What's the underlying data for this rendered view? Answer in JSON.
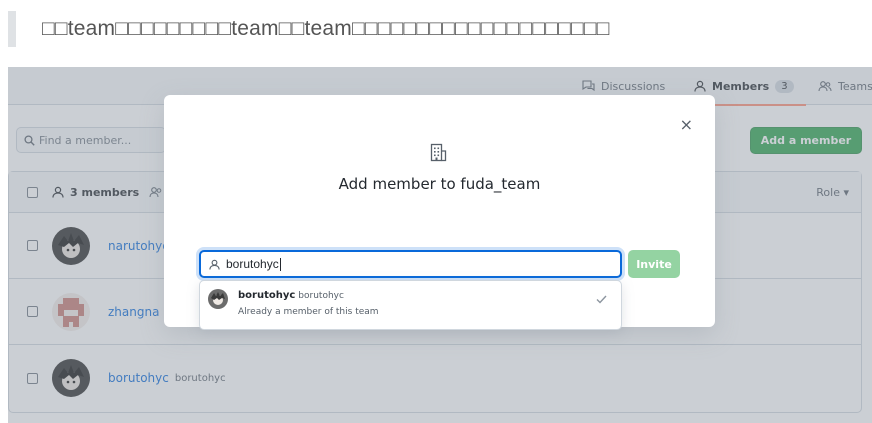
{
  "doc": {
    "heading": "□□team□□□□□□□□□team□□team□□□□□□□□□□□□□□□□□□□□"
  },
  "tabs": {
    "discussions": "Discussions",
    "members": "Members",
    "members_count": "3",
    "teams": "Teams"
  },
  "toolbar": {
    "find_placeholder": "Find a member...",
    "add_member": "Add a member"
  },
  "members": {
    "header_count": "3 members",
    "role_label": "Role ▾",
    "rows": [
      {
        "name": "narutohyc",
        "login": ""
      },
      {
        "name": "zhangna",
        "login": ""
      },
      {
        "name": "borutohyc",
        "login": "borutohyc"
      }
    ]
  },
  "dialog": {
    "title": "Add member to fuda_team",
    "close": "×",
    "search_value": "borutohyc",
    "invite": "Invite",
    "suggestion": {
      "name": "borutohyc",
      "login": "borutohyc",
      "note": "Already a member of this team"
    }
  },
  "colors": {
    "accent_blue": "#0969da",
    "green": "#2da44e",
    "green_disabled": "#94d3a2",
    "tab_underline": "#fd8c73"
  }
}
